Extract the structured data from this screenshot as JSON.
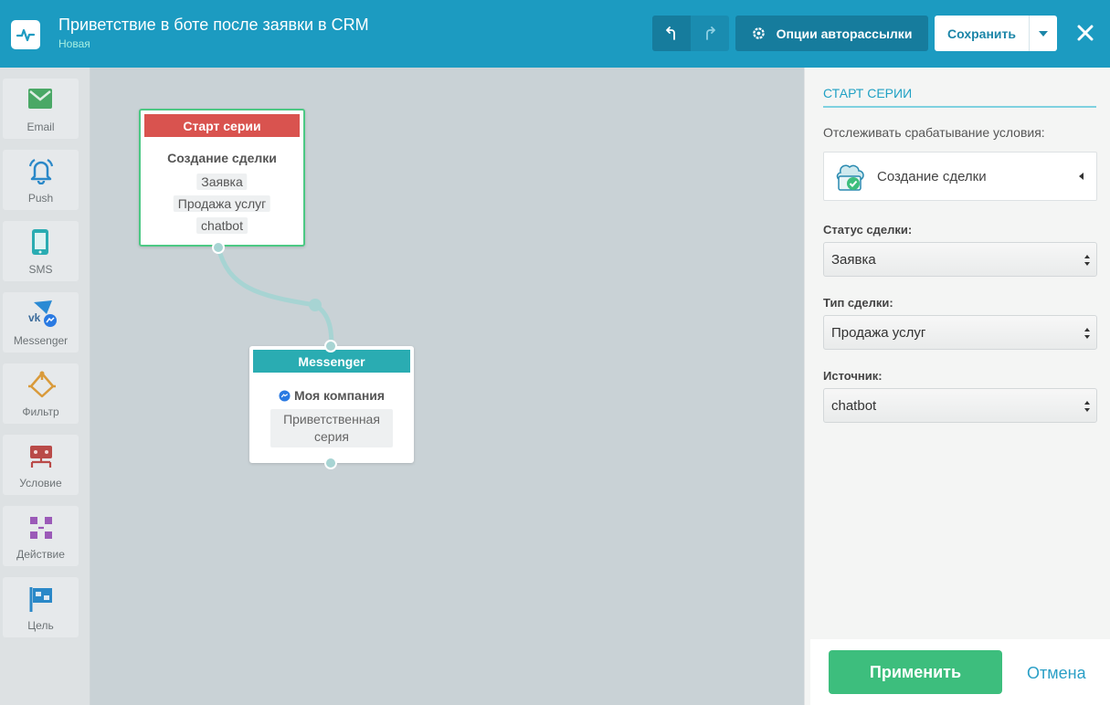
{
  "header": {
    "title": "Приветствие в боте после заявки в CRM",
    "subtitle": "Новая",
    "options_label": "Опции авторассылки",
    "save_label": "Сохранить"
  },
  "sidebar": {
    "items": [
      {
        "label": "Email",
        "icon": "email-icon"
      },
      {
        "label": "Push",
        "icon": "bell-icon"
      },
      {
        "label": "SMS",
        "icon": "phone-icon"
      },
      {
        "label": "Messenger",
        "icon": "messenger-icon"
      },
      {
        "label": "Фильтр",
        "icon": "filter-icon"
      },
      {
        "label": "Условие",
        "icon": "condition-icon"
      },
      {
        "label": "Действие",
        "icon": "action-icon"
      },
      {
        "label": "Цель",
        "icon": "flag-icon"
      }
    ]
  },
  "canvas": {
    "start_node": {
      "header": "Старт серии",
      "subtitle": "Создание сделки",
      "chips": [
        "Заявка",
        "Продажа услуг",
        "chatbot"
      ]
    },
    "messenger_node": {
      "header": "Messenger",
      "company": "Моя компания",
      "series": "Приветственная серия"
    }
  },
  "panel": {
    "title": "СТАРТ СЕРИИ",
    "track_label": "Отслеживать срабатывание условия:",
    "trigger_value": "Создание сделки",
    "status_label": "Статус сделки:",
    "status_value": "Заявка",
    "type_label": "Тип сделки:",
    "type_value": "Продажа услуг",
    "source_label": "Источник:",
    "source_value": "chatbot",
    "apply_label": "Применить",
    "cancel_label": "Отмена"
  },
  "colors": {
    "header": "#1c9bc1",
    "start": "#d9534f",
    "messenger": "#2aacb2",
    "apply": "#3dbe7d"
  }
}
